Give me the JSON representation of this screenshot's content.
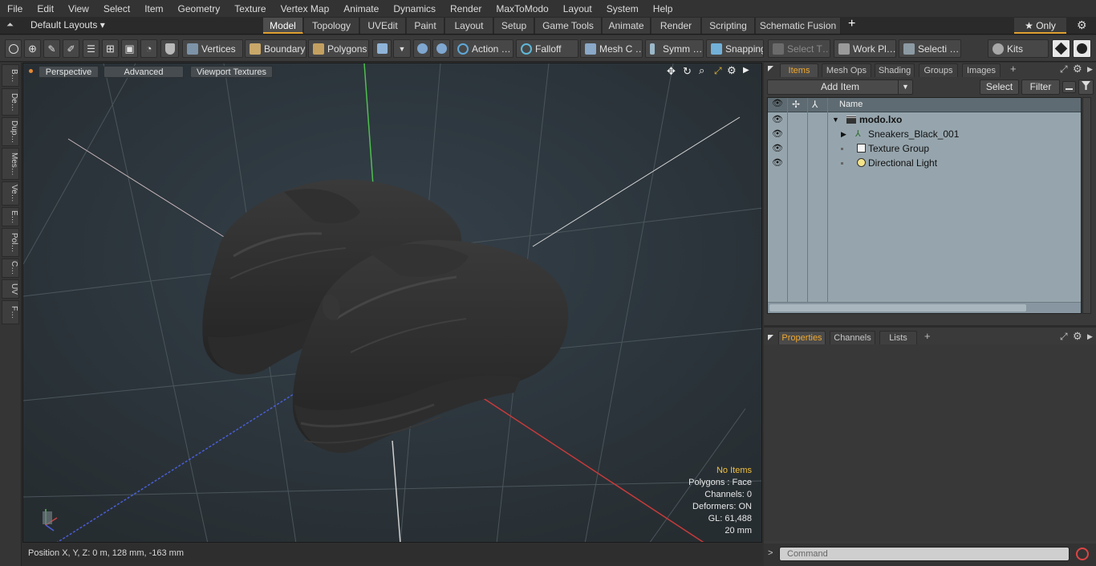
{
  "menu": [
    "File",
    "Edit",
    "View",
    "Select",
    "Item",
    "Geometry",
    "Texture",
    "Vertex Map",
    "Animate",
    "Dynamics",
    "Render",
    "MaxToModo",
    "Layout",
    "System",
    "Help"
  ],
  "layout": {
    "preset": "Default Layouts ▾",
    "tabs": [
      "Model",
      "Topology",
      "UVEdit",
      "Paint",
      "Layout",
      "Setup",
      "Game Tools",
      "Animate",
      "Render",
      "Scripting",
      "Schematic Fusion"
    ],
    "active_tab": "Model",
    "add_label": "+",
    "only_label": "★ Only"
  },
  "toolbar": {
    "vertices": "Vertices",
    "boundary": "Boundary",
    "polygons": "Polygons",
    "action": "Action …",
    "falloff": "Falloff",
    "mesh": "Mesh C …",
    "symm": "Symm …",
    "snapping": "Snapping",
    "select_t": "Select T…",
    "workplane": "Work Pl…",
    "selecti": "Selecti …",
    "kits": "Kits"
  },
  "left_tabs": [
    "B…",
    "De…",
    "Dup…",
    "Mes…",
    "Ve…",
    "E…",
    "Pol…",
    "C…",
    "UV",
    "F…"
  ],
  "viewport": {
    "perspective": "Perspective",
    "advanced": "Advanced",
    "viewport_textures": "Viewport Textures"
  },
  "stats": {
    "no_items": "No Items",
    "polygons": "Polygons : Face",
    "channels": "Channels: 0",
    "deformers": "Deformers: ON",
    "gl": "GL: 61,488",
    "scale": "20 mm"
  },
  "status": {
    "position": "Position X, Y, Z:   0 m, 128 mm, -163 mm"
  },
  "items_panel": {
    "tabs": [
      "Items",
      "Mesh Ops",
      "Shading",
      "Groups",
      "Images"
    ],
    "active_tab": "Items",
    "add_item": "Add Item",
    "select": "Select",
    "filter": "Filter",
    "name_header": "Name",
    "tree": [
      {
        "label": "modo.lxo",
        "indent": 0,
        "bold": true
      },
      {
        "label": "Sneakers_Black_001",
        "indent": 1,
        "bold": false
      },
      {
        "label": "Texture Group",
        "indent": 1,
        "bold": false
      },
      {
        "label": "Directional Light",
        "indent": 1,
        "bold": false
      }
    ]
  },
  "props_panel": {
    "tabs": [
      "Properties",
      "Channels",
      "Lists"
    ],
    "active_tab": "Properties"
  },
  "command": {
    "placeholder": "Command",
    "prompt": ">"
  },
  "colors": {
    "accent": "#e0a030",
    "viewport_bg": "#2b3337",
    "list_bg": "#96a5ad"
  }
}
